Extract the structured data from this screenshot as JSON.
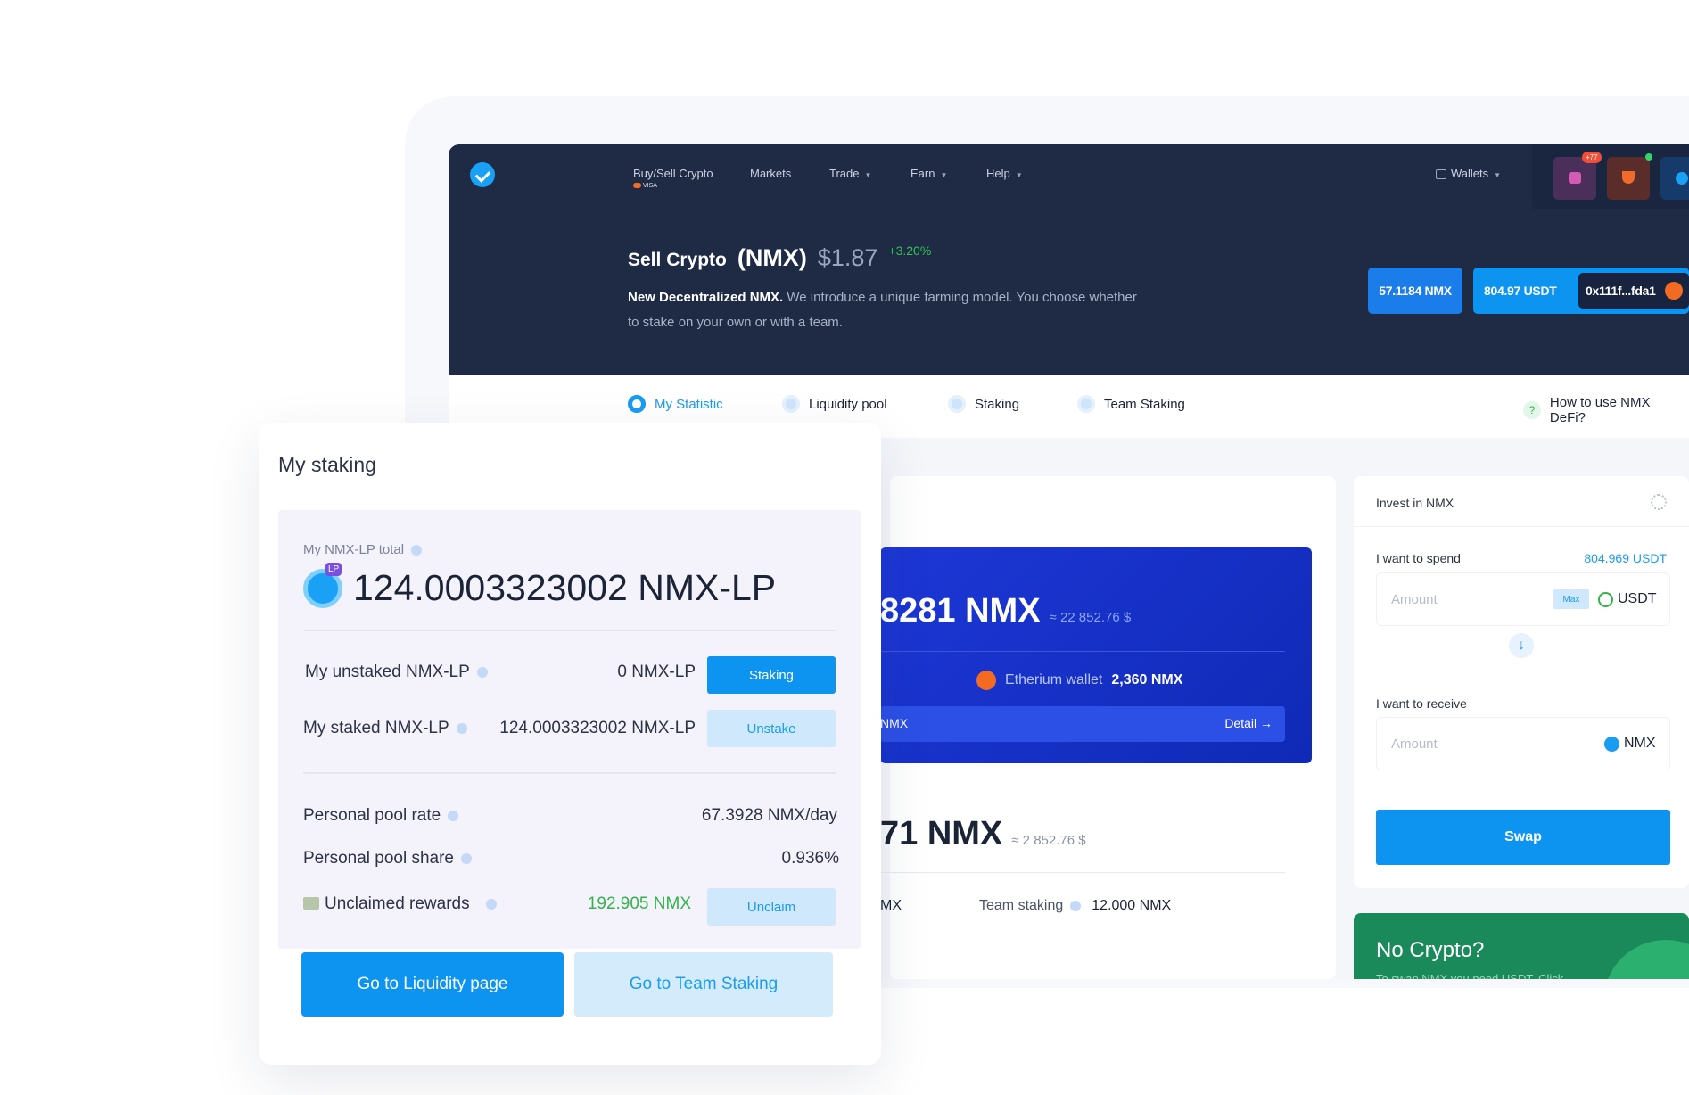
{
  "colors": {
    "navy": "#1f2b45",
    "accent": "#0d94f0",
    "green": "#32b44a",
    "lavender": "#f4f2fb"
  },
  "header": {
    "nav": [
      {
        "label": "Buy/Sell Crypto",
        "caret": false
      },
      {
        "label": "Markets",
        "caret": false
      },
      {
        "label": "Trade",
        "caret": true
      },
      {
        "label": "Earn",
        "caret": true
      },
      {
        "label": "Help",
        "caret": true
      }
    ],
    "visa_badge": "VISA",
    "wallets_label": "Wallets",
    "notif_badge": "+77",
    "title_prefix": "Sell Crypto",
    "title_ticker": "(NMX)",
    "price": "$1.87",
    "change": "+3.20%",
    "desc_bold": "New Decentralized NMX.",
    "desc_rest": " We introduce a unique farming model. You choose whether to stake on your own or with a team.",
    "nmx_balance": "57.1184 NMX",
    "usdt_balance": "804.97 USDT",
    "address": "0x111f...fda1"
  },
  "tabs": [
    {
      "label": "My Statistic",
      "icon": "chart-icon"
    },
    {
      "label": "Liquidity pool",
      "icon": "drop-icon"
    },
    {
      "label": "Staking",
      "icon": "coin-icon"
    },
    {
      "label": "Team Staking",
      "icon": "team-icon"
    }
  ],
  "help_link": "How to use NMX DeFi?",
  "center": {
    "blue_amount": "8281 NMX",
    "blue_usd": "≈ 22 852.76 $",
    "eth_label": "Etherium wallet",
    "eth_amount": "2,360 NMX",
    "strip_label": "NMX",
    "detail_label": "Detail",
    "lower_amount": "71 NMX",
    "lower_usd": "≈ 2 852.76 $",
    "bottom_left": "MX",
    "team_staking_label": "Team staking",
    "team_staking_value": "12.000 NMX"
  },
  "invest": {
    "title": "Invest in NMX",
    "spend_label": "I want to spend",
    "spend_balance": "804.969 USDT",
    "amount_placeholder": "Amount",
    "max_label": "Max",
    "spend_currency": "USDT",
    "receive_label": "I want to receive",
    "receive_currency": "NMX",
    "swap_label": "Swap"
  },
  "promo": {
    "title": "No Crypto?",
    "sub": "To swap NMX you need USDT. Click"
  },
  "staking": {
    "title": "My staking",
    "total_label": "My NMX-LP total",
    "lp_badge": "LP",
    "total_value": "124.0003323002 NMX-LP",
    "unstaked_label": "My unstaked NMX-LP",
    "unstaked_value": "0 NMX-LP",
    "staking_button": "Staking",
    "staked_label": "My staked NMX-LP",
    "staked_value": "124.0003323002 NMX-LP",
    "unstake_button": "Unstake",
    "rate_label": "Personal pool rate",
    "rate_value": "67.3928 NMX/day",
    "share_label": "Personal pool share",
    "share_value": "0.936%",
    "rewards_label": "Unclaimed rewards",
    "rewards_value": "192.905 NMX",
    "unclaim_button": "Unclaim",
    "liquidity_button": "Go to Liquidity page",
    "team_button": "Go to Team Staking"
  }
}
